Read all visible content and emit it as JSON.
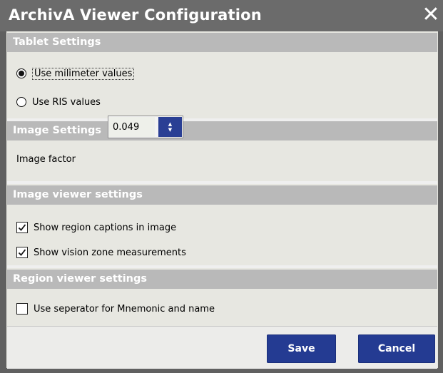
{
  "window": {
    "title": "ArchivA Viewer Configuration",
    "close_symbol": "✕"
  },
  "tablet": {
    "header": "Tablet Settings",
    "options": [
      {
        "label": "Use milimeter values",
        "selected": true
      },
      {
        "label": "Use RIS values",
        "selected": false
      }
    ]
  },
  "image": {
    "header": "Image Settings",
    "factor_label": "Image factor",
    "factor_value": "0.049"
  },
  "image_viewer": {
    "header": "Image viewer settings",
    "options": [
      {
        "label": "Show region captions in image",
        "checked": true
      },
      {
        "label": "Show vision zone measurements",
        "checked": true
      }
    ]
  },
  "region_viewer": {
    "header": "Region viewer settings",
    "options": [
      {
        "label": "Use seperator for Mnemonic and name",
        "checked": false
      }
    ]
  },
  "buttons": {
    "save": "Save",
    "cancel": "Cancel"
  },
  "colors": {
    "accent": "#243b92",
    "title_bar": "#6b6b6b",
    "section_header": "#b9b9b9"
  }
}
